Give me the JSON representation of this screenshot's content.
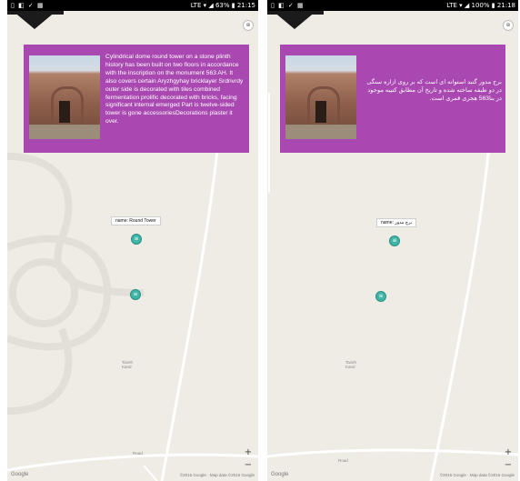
{
  "left_screen": {
    "status": {
      "icons": "▯ ◧ ✓ ▦",
      "right": "LTE ▾ ◢ 63% ▮ 21:15"
    },
    "card": {
      "text": "Cylindrical dome round tower on a stone plinth history has been built on two floors in accordance with the inscription on the monument 563 AH. It also covers certain Aryzhgyhay bricklayer Srdrivrdy outer side is decorated with tiles combined fermentation prolific decorated with bricks, facing significant internal emerged Part is twelve-sided tower is gone accessoriesDecorations plaster it over."
    },
    "marker_label": "name: Round Tower",
    "place_label": "Tazeh\nKand",
    "road_label": "Road",
    "google": "Google",
    "attribution": "©2016 Google · Map data ©2016 Google",
    "zoom_in": "+",
    "zoom_out": "−"
  },
  "right_screen": {
    "status": {
      "icons": "▯ ◧ ✓ ▦",
      "right": "LTE ▾ ◢ 100% ▮ 21:18"
    },
    "card": {
      "text": "برج مدور گنبد استوانه ای است که بر روی ازاره سنگی در دو طبقه ساخته شده و تاریخ آن مطابق کتیبه موجود در بنا563 هجری قمری است."
    },
    "marker_label": "name: برج مدور",
    "place_label": "Tazeh\nKand",
    "road_label": "Road",
    "google": "Google",
    "attribution": "©2016 Google · Map data ©2016 Google",
    "zoom_in": "+",
    "zoom_out": "−"
  },
  "icons": {
    "nav": "nav-drawer-tab-icon",
    "compass": "compass-icon",
    "marker": "map-marker-icon"
  },
  "colors": {
    "card": "#a848b0",
    "marker": "#3fb5a7",
    "map": "#efece6"
  }
}
